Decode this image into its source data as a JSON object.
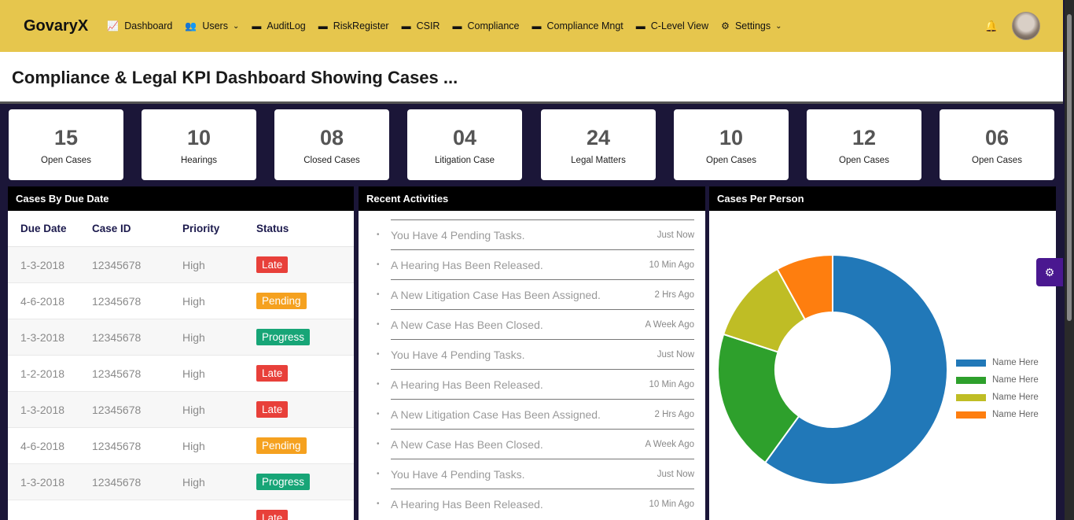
{
  "nav": {
    "brand": "GovaryX",
    "items": [
      {
        "label": "Dashboard",
        "icon": "chart-line-icon"
      },
      {
        "label": "Users",
        "icon": "users-icon",
        "dropdown": true
      },
      {
        "label": "AuditLog",
        "icon": "list-icon"
      },
      {
        "label": "RiskRegister",
        "icon": "list-icon"
      },
      {
        "label": "CSIR",
        "icon": "list-icon"
      },
      {
        "label": "Compliance",
        "icon": "list-icon"
      },
      {
        "label": "Compliance Mngt",
        "icon": "list-icon"
      },
      {
        "label": "C-Level View",
        "icon": "list-icon"
      },
      {
        "label": "Settings",
        "icon": "gear-icon",
        "dropdown": true
      }
    ]
  },
  "page_title": "Compliance & Legal KPI Dashboard Showing Cases ...",
  "kpis": [
    {
      "value": "15",
      "label": "Open Cases"
    },
    {
      "value": "10",
      "label": "Hearings"
    },
    {
      "value": "08",
      "label": "Closed Cases"
    },
    {
      "value": "04",
      "label": "Litigation Case"
    },
    {
      "value": "24",
      "label": "Legal Matters"
    },
    {
      "value": "10",
      "label": "Open Cases"
    },
    {
      "value": "12",
      "label": "Open Cases"
    },
    {
      "value": "06",
      "label": "Open Cases"
    }
  ],
  "cases": {
    "title": "Cases By Due Date",
    "columns": [
      "Due Date",
      "Case ID",
      "Priority",
      "Status"
    ],
    "rows": [
      {
        "date": "1-3-2018",
        "id": "12345678",
        "priority": "High",
        "status": "Late"
      },
      {
        "date": "4-6-2018",
        "id": "12345678",
        "priority": "High",
        "status": "Pending"
      },
      {
        "date": "1-3-2018",
        "id": "12345678",
        "priority": "High",
        "status": "Progress"
      },
      {
        "date": "1-2-2018",
        "id": "12345678",
        "priority": "High",
        "status": "Late"
      },
      {
        "date": "1-3-2018",
        "id": "12345678",
        "priority": "High",
        "status": "Late"
      },
      {
        "date": "4-6-2018",
        "id": "12345678",
        "priority": "High",
        "status": "Pending"
      },
      {
        "date": "1-3-2018",
        "id": "12345678",
        "priority": "High",
        "status": "Progress"
      },
      {
        "date": "",
        "id": "",
        "priority": "",
        "status": "Late"
      }
    ],
    "status_colors": {
      "Late": "#e8403a",
      "Pending": "#f5a11f",
      "Progress": "#17a577"
    }
  },
  "activities": {
    "title": "Recent Activities",
    "items": [
      {
        "text": "You Have 4 Pending Tasks.",
        "time": "Just Now"
      },
      {
        "text": "A Hearing Has Been Released.",
        "time": "10 Min Ago"
      },
      {
        "text": "A New Litigation Case Has Been Assigned.",
        "time": "2 Hrs Ago"
      },
      {
        "text": "A New Case Has Been Closed.",
        "time": "A Week Ago"
      },
      {
        "text": "You Have 4 Pending Tasks.",
        "time": "Just Now"
      },
      {
        "text": "A Hearing Has Been Released.",
        "time": "10 Min Ago"
      },
      {
        "text": "A New Litigation Case Has Been Assigned.",
        "time": "2 Hrs Ago"
      },
      {
        "text": "A New Case Has Been Closed.",
        "time": "A Week Ago"
      },
      {
        "text": "You Have 4 Pending Tasks.",
        "time": "Just Now"
      },
      {
        "text": "A Hearing Has Been Released.",
        "time": "10 Min Ago"
      }
    ]
  },
  "per_person": {
    "title": "Cases Per Person"
  },
  "chart_data": {
    "type": "pie",
    "series": [
      {
        "name": "Name Here",
        "value": 60,
        "color": "#2178b8"
      },
      {
        "name": "Name Here",
        "value": 20,
        "color": "#2ea02c"
      },
      {
        "name": "Name Here",
        "value": 12,
        "color": "#bfbd25"
      },
      {
        "name": "Name Here",
        "value": 8,
        "color": "#fe7e0f"
      }
    ],
    "donut": true,
    "legend": "right"
  }
}
